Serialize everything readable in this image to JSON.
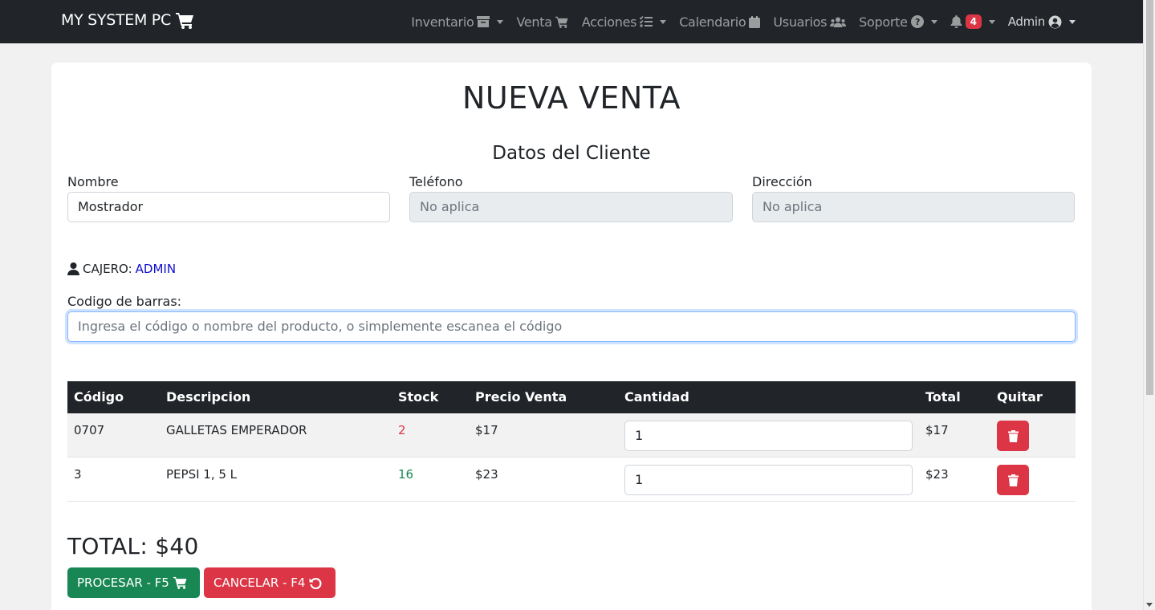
{
  "navbar": {
    "brand": "MY SYSTEM PC",
    "items": [
      {
        "label": "Inventario",
        "icon": "archive-icon",
        "dropdown": true
      },
      {
        "label": "Venta",
        "icon": "cart-icon",
        "dropdown": false
      },
      {
        "label": "Acciones",
        "icon": "tasks-icon",
        "dropdown": true
      },
      {
        "label": "Calendario",
        "icon": "calendar-icon",
        "dropdown": false
      },
      {
        "label": "Usuarios",
        "icon": "users-icon",
        "dropdown": false
      },
      {
        "label": "Soporte",
        "icon": "question-circle-icon",
        "dropdown": true
      }
    ],
    "notifications_count": "4",
    "user_label": "Admin"
  },
  "page": {
    "title": "NUEVA VENTA",
    "subtitle": "Datos del Cliente"
  },
  "cliente": {
    "nombre_label": "Nombre",
    "nombre_value": "Mostrador",
    "telefono_label": "Teléfono",
    "telefono_value": "No aplica",
    "direccion_label": "Dirección",
    "direccion_value": "No aplica"
  },
  "cajero": {
    "label": "CAJERO:",
    "name": "ADMIN"
  },
  "barcode": {
    "label": "Codigo de barras:",
    "placeholder": "Ingresa el código o nombre del producto, o simplemente escanea el código"
  },
  "table": {
    "headers": {
      "codigo": "Código",
      "descripcion": "Descripcion",
      "stock": "Stock",
      "precio": "Precio Venta",
      "cantidad": "Cantidad",
      "total": "Total",
      "quitar": "Quitar"
    },
    "rows": [
      {
        "codigo": "0707",
        "descripcion": "GALLETAS EMPERADOR",
        "stock": "2",
        "precio": "$17",
        "cantidad": "1",
        "total": "$17"
      },
      {
        "codigo": "3",
        "descripcion": "PEPSI 1, 5 L",
        "stock": "16",
        "precio": "$23",
        "cantidad": "1",
        "total": "$23"
      }
    ]
  },
  "summary": {
    "total": "TOTAL: $40"
  },
  "actions": {
    "procesar": "PROCESAR - F5",
    "cancelar": "CANCELAR - F4"
  },
  "colors": {
    "navbar_bg": "#212529",
    "success": "#198754",
    "danger": "#dc3545",
    "cashier_name": "#0d0dcc"
  }
}
